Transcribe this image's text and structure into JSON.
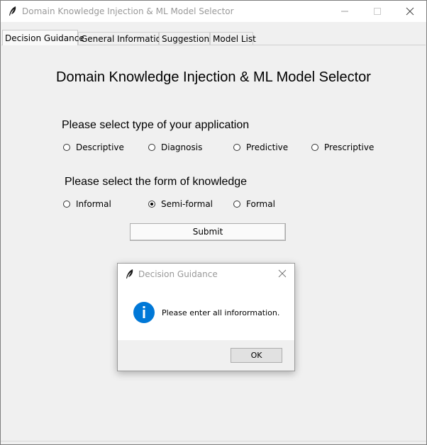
{
  "window": {
    "title": "Domain Knowledge Injection & ML Model Selector"
  },
  "tabs": [
    {
      "label": "Decision Guidance"
    },
    {
      "label": "General Information"
    },
    {
      "label": "Suggestions"
    },
    {
      "label": "Model List"
    }
  ],
  "main": {
    "heading": "Domain Knowledge Injection & ML Model Selector",
    "application_prompt": "Please select type of your application",
    "application_options": [
      {
        "label": "Descriptive",
        "checked": false
      },
      {
        "label": "Diagnosis",
        "checked": false
      },
      {
        "label": "Predictive",
        "checked": false
      },
      {
        "label": "Prescriptive",
        "checked": false
      }
    ],
    "knowledge_prompt": "Please select the form of knowledge",
    "knowledge_options": [
      {
        "label": "Informal",
        "checked": false
      },
      {
        "label": "Semi-formal",
        "checked": true
      },
      {
        "label": "Formal",
        "checked": false
      }
    ],
    "submit_label": "Submit"
  },
  "dialog": {
    "title": "Decision Guidance",
    "message": "Please enter all inforormation.",
    "ok_label": "OK",
    "icon": "info-icon",
    "icon_color": "#0078d7"
  }
}
